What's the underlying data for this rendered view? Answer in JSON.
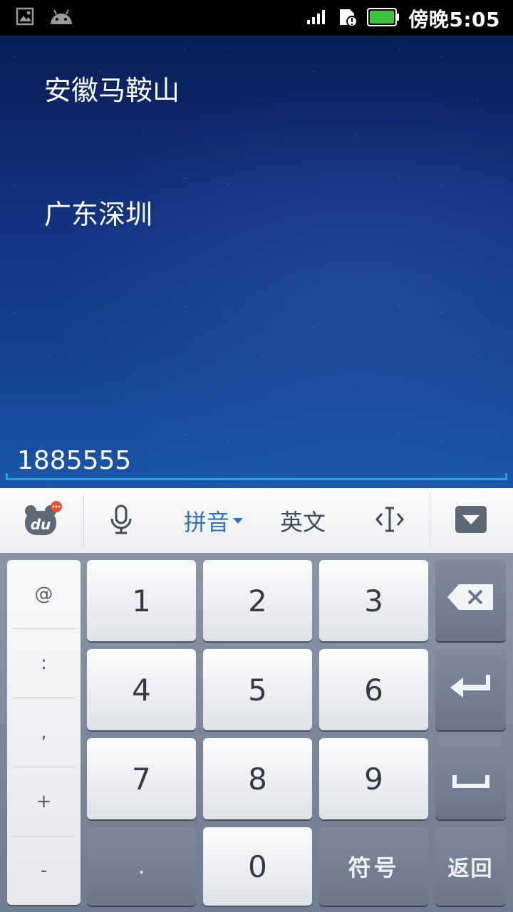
{
  "status_bar": {
    "time": "傍晚5:05",
    "battery_color": "#38c23b",
    "icons": [
      "image-notification-icon",
      "android-notification-icon",
      "signal-icon",
      "sim-alert-icon",
      "battery-icon"
    ]
  },
  "content": {
    "locations": [
      "安徽马鞍山",
      "广东深圳"
    ],
    "input_value": "1885555"
  },
  "toolbar": {
    "logo": "du",
    "mode_pinyin": "拼音",
    "mode_english": "英文",
    "icons": [
      "baidu-logo-icon",
      "microphone-icon",
      "cursor-icon",
      "collapse-keyboard-icon"
    ]
  },
  "keyboard": {
    "symbols": [
      "@",
      ":",
      ",",
      "+",
      "-"
    ],
    "digits": [
      "1",
      "2",
      "3",
      "4",
      "5",
      "6",
      "7",
      "8",
      "9",
      "0"
    ],
    "dot": ".",
    "symbols_key": "符号",
    "back_key": "返回"
  },
  "colors": {
    "accent_blue": "#2f6fcc",
    "input_underline": "#2a9fe6"
  }
}
